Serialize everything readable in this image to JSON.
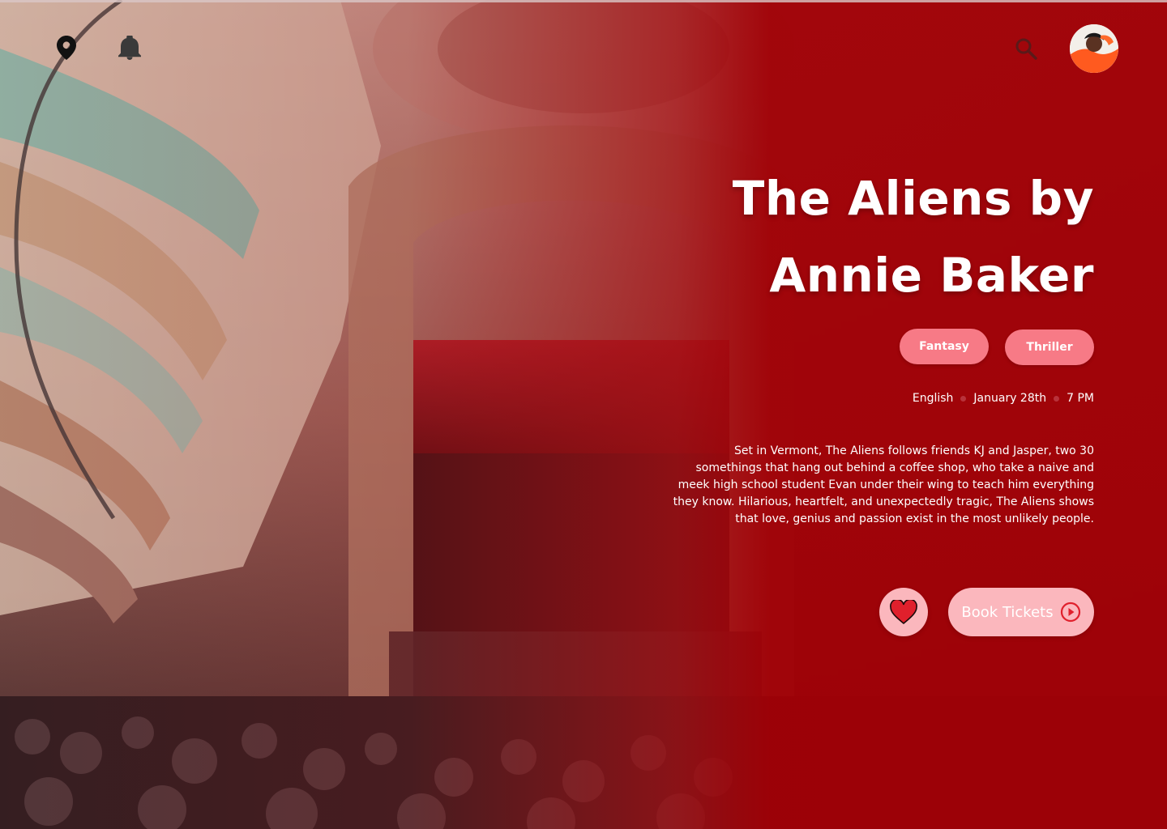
{
  "header": {
    "icons": [
      "location-pin-icon",
      "bell-icon",
      "search-icon"
    ],
    "avatar": "user-avatar"
  },
  "event": {
    "title": "The Aliens by Annie Baker",
    "tags": [
      "Fantasy",
      "Thriller"
    ],
    "language": "English",
    "date": "January 28th",
    "time": "7 PM",
    "description": "Set in Vermont, The Aliens follows friends KJ and Jasper, two 30 somethings that hang out behind a coffee shop, who take a naive and meek high school student Evan under their wing to teach him everything they know. Hilarious, heartfelt, and unexpectedly tragic, The Aliens shows that love, genius and passion exist in the most unlikely people."
  },
  "actions": {
    "favorite_icon": "heart-icon",
    "book_label": "Book Tickets",
    "book_icon": "play-circle-icon"
  },
  "colors": {
    "accent_red": "#a00006",
    "tag_pink": "#f77a86",
    "button_pink": "#fbb7bd",
    "heart_red": "#e0202c"
  }
}
